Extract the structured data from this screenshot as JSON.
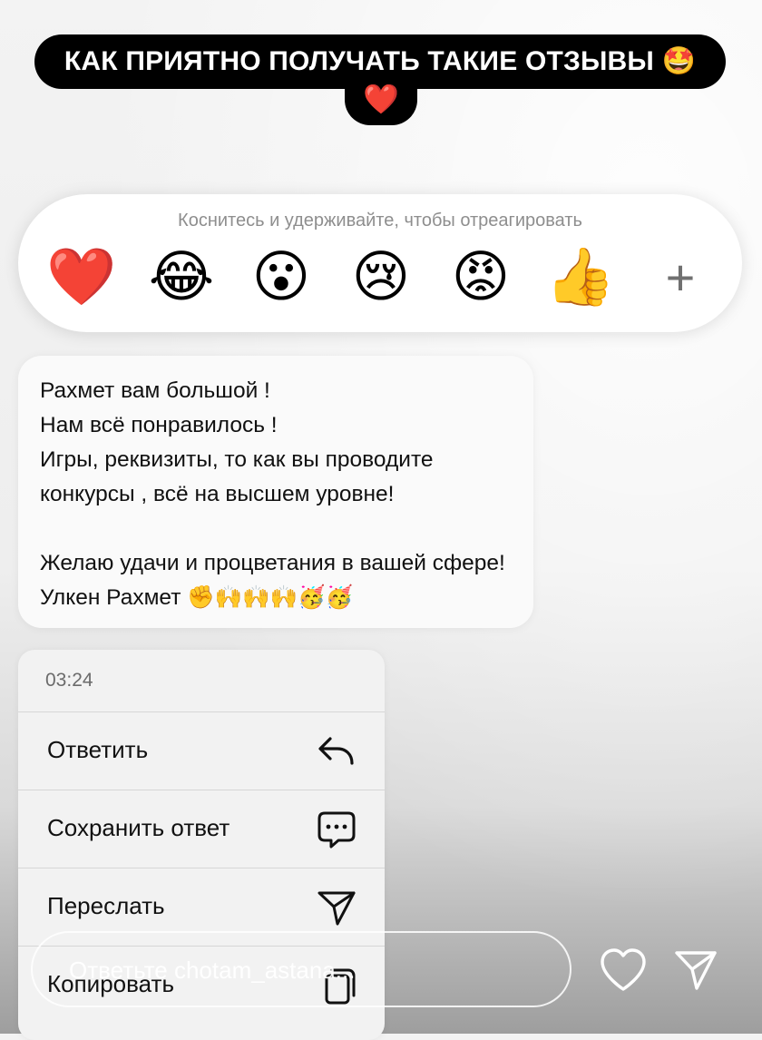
{
  "caption": {
    "line1": "КАК ПРИЯТНО ПОЛУЧАТЬ ТАКИЕ ОТЗЫВЫ 🤩",
    "line2": "❤️"
  },
  "reaction_bar": {
    "hint": "Коснитесь и удерживайте, чтобы отреагировать",
    "reactions": [
      {
        "emoji": "❤️",
        "name": "heart"
      },
      {
        "emoji": "😂",
        "name": "laughing"
      },
      {
        "emoji": "😮",
        "name": "surprised"
      },
      {
        "emoji": "😢",
        "name": "crying"
      },
      {
        "emoji": "😡",
        "name": "angry"
      },
      {
        "emoji": "👍",
        "name": "thumbs-up"
      }
    ],
    "more": "+"
  },
  "message": {
    "text": "Рахмет вам большой !\nНам всё понравилось !\nИгры, реквизиты, то как вы проводите конкурсы , всё на высшем уровне!\n\nЖелаю удачи и процветания в вашей сфере! Улкен Рахмет ✊🙌🙌🙌🥳🥳"
  },
  "context_menu": {
    "time": "03:24",
    "items": [
      {
        "label": "Ответить",
        "icon": "reply-icon"
      },
      {
        "label": "Сохранить ответ",
        "icon": "saved-reply-icon"
      },
      {
        "label": "Переслать",
        "icon": "forward-icon"
      },
      {
        "label": "Копировать",
        "icon": "copy-icon"
      }
    ]
  },
  "reply_bar": {
    "placeholder": "Ответьте chotam_astana...",
    "like_icon": "heart-outline-icon",
    "send_icon": "send-icon"
  },
  "colors": {
    "caption_bg": "#000000",
    "menu_bg": "#f2f2f2",
    "bubble_bg": "#fafafa"
  }
}
